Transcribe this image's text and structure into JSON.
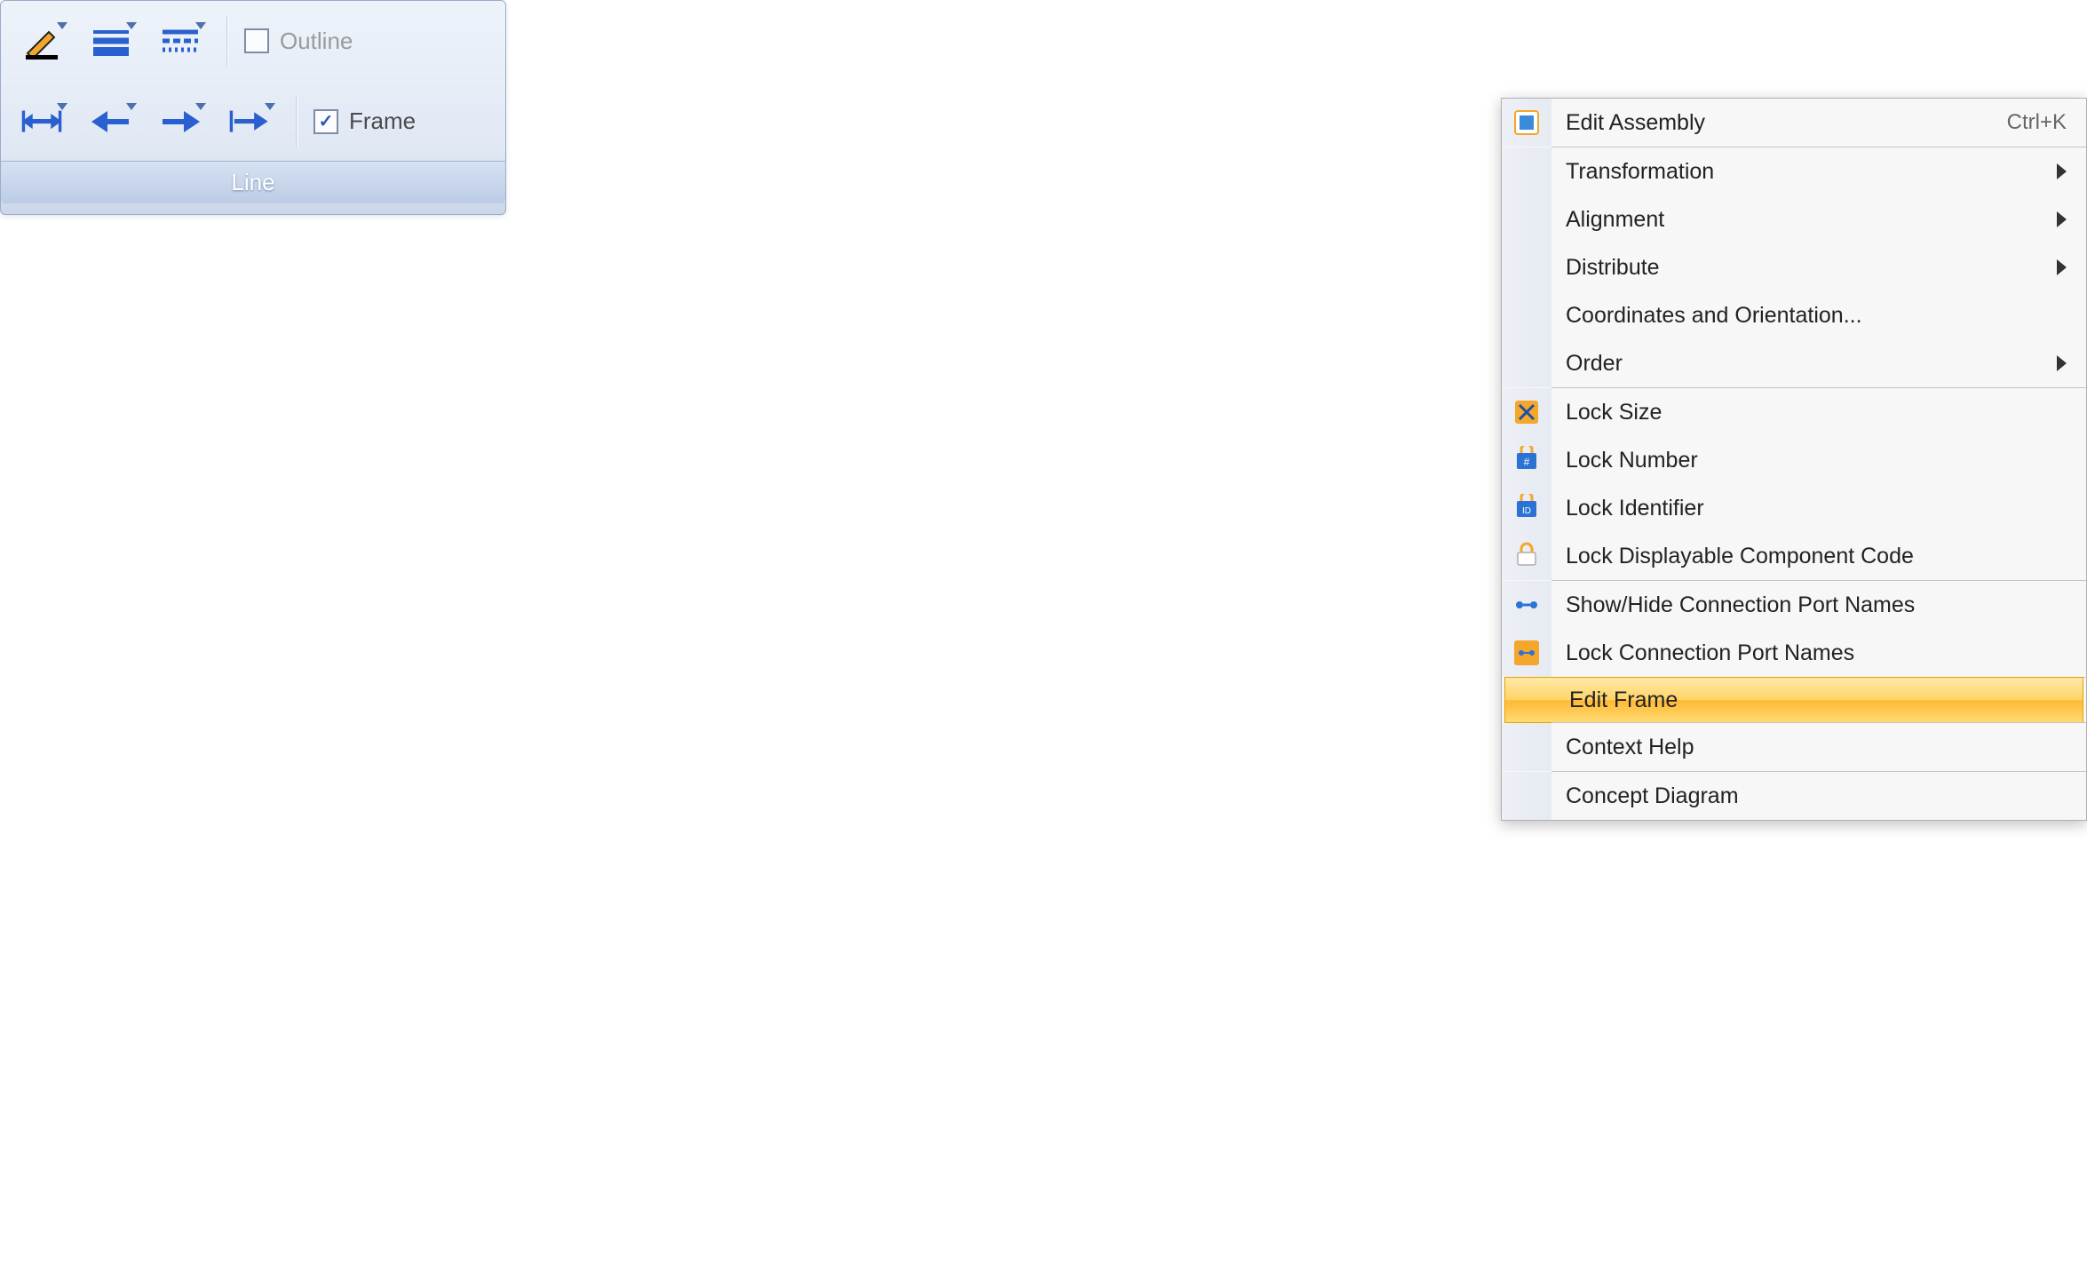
{
  "ribbon": {
    "panel_label": "Line",
    "outline_label": "Outline",
    "outline_checked": false,
    "frame_label": "Frame",
    "frame_checked": true,
    "buttons_row1": [
      "line-color",
      "line-style",
      "line-dash"
    ],
    "buttons_row2": [
      "arrow-both",
      "arrow-left",
      "arrow-right",
      "arrow-right-double"
    ]
  },
  "ctx": {
    "edit_assembly": "Edit Assembly",
    "edit_assembly_shortcut": "Ctrl+K",
    "transformation": "Transformation",
    "alignment": "Alignment",
    "distribute": "Distribute",
    "coords": "Coordinates and Orientation...",
    "order": "Order",
    "lock_size": "Lock Size",
    "lock_number": "Lock Number",
    "lock_identifier": "Lock Identifier",
    "lock_code": "Lock Displayable Component Code",
    "show_hide_ports": "Show/Hide Connection Port Names",
    "lock_ports": "Lock Connection Port Names",
    "edit_frame": "Edit Frame",
    "context_help": "Context Help",
    "concept_diagram": "Concept Diagram"
  },
  "colors": {
    "ribbon_blue": "#2a5fcf",
    "orange": "#f4a72b",
    "green_frame": "#1fae3a",
    "cyan_frame": "#19b4ea",
    "schematic_blue": "#1429d3"
  }
}
